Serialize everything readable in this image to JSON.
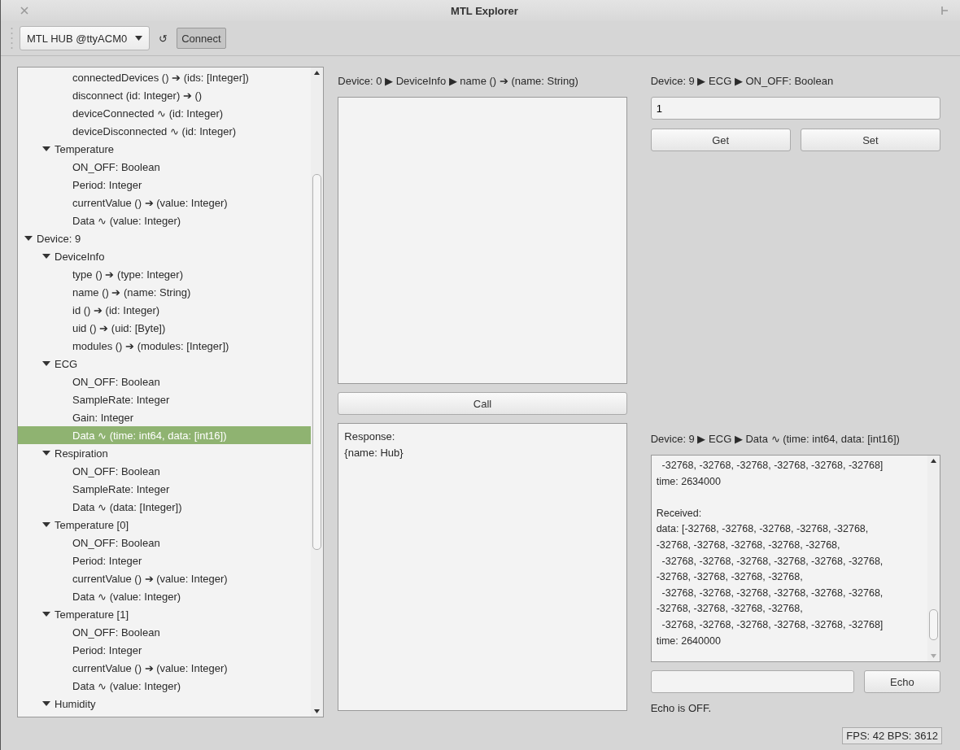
{
  "window": {
    "title": "MTL Explorer"
  },
  "toolbar": {
    "device_select": "MTL HUB @ttyACM0",
    "refresh": "↺",
    "connect": {
      "label": "Connect",
      "pressed": true
    }
  },
  "tree": {
    "items": [
      {
        "children": [
          {
            "children": [
              {
                "label": "connectedDevices () ➔ (ids: [Integer])",
                "selected": false
              },
              {
                "label": "disconnect (id: Integer) ➔ ()",
                "selected": false
              },
              {
                "label": "deviceConnected ∿ (id: Integer)",
                "selected": false
              },
              {
                "label": "deviceDisconnected ∿ (id: Integer)",
                "selected": false
              }
            ]
          },
          {
            "label": "Temperature",
            "expanded": true,
            "children": [
              {
                "label": "ON_OFF: Boolean",
                "selected": false
              },
              {
                "label": "Period: Integer",
                "selected": false
              },
              {
                "label": "currentValue () ➔ (value: Integer)",
                "selected": false
              },
              {
                "label": "Data ∿ (value: Integer)",
                "selected": false
              }
            ]
          }
        ]
      },
      {
        "label": "Device: 9",
        "expanded": true,
        "children": [
          {
            "label": "DeviceInfo",
            "expanded": true,
            "children": [
              {
                "label": "type () ➔ (type: Integer)",
                "selected": false
              },
              {
                "label": "name () ➔ (name: String)",
                "selected": false
              },
              {
                "label": "id () ➔ (id: Integer)",
                "selected": false
              },
              {
                "label": "uid () ➔ (uid: [Byte])",
                "selected": false
              },
              {
                "label": "modules () ➔ (modules: [Integer])",
                "selected": false
              }
            ]
          },
          {
            "label": "ECG",
            "expanded": true,
            "children": [
              {
                "label": "ON_OFF: Boolean",
                "selected": false
              },
              {
                "label": "SampleRate: Integer",
                "selected": false
              },
              {
                "label": "Gain: Integer",
                "selected": false
              },
              {
                "label": "Data ∿ (time: int64, data: [int16])",
                "selected": true
              }
            ]
          },
          {
            "label": "Respiration",
            "expanded": true,
            "children": [
              {
                "label": "ON_OFF: Boolean",
                "selected": false
              },
              {
                "label": "SampleRate: Integer",
                "selected": false
              },
              {
                "label": "Data ∿ (data: [Integer])",
                "selected": false
              }
            ]
          },
          {
            "label": "Temperature [0]",
            "expanded": true,
            "children": [
              {
                "label": "ON_OFF: Boolean",
                "selected": false
              },
              {
                "label": "Period: Integer",
                "selected": false
              },
              {
                "label": "currentValue () ➔ (value: Integer)",
                "selected": false
              },
              {
                "label": "Data ∿ (value: Integer)",
                "selected": false
              }
            ]
          },
          {
            "label": "Temperature [1]",
            "expanded": true,
            "children": [
              {
                "label": "ON_OFF: Boolean",
                "selected": false
              },
              {
                "label": "Period: Integer",
                "selected": false
              },
              {
                "label": "currentValue () ➔ (value: Integer)",
                "selected": false
              },
              {
                "label": "Data ∿ (value: Integer)",
                "selected": false
              }
            ]
          },
          {
            "label": "Humidity",
            "expanded": true
          }
        ]
      }
    ]
  },
  "call_panel": {
    "path": "Device: 0 ▶ DeviceInfo ▶ name () ➔ (name: String)",
    "button": "Call",
    "response": "Response:\n{name: Hub}"
  },
  "property_panel": {
    "path": "Device: 9 ▶ ECG ▶ ON_OFF: Boolean",
    "value": "1",
    "buttons": [
      "Get",
      "Set"
    ]
  },
  "stream_panel": {
    "path": "Device: 9 ▶ ECG ▶ Data ∿ (time: int64, data: [int16])",
    "log": "  -32768, -32768, -32768, -32768, -32768, -32768]\ntime: 2634000\n\nReceived:\ndata: [-32768, -32768, -32768, -32768, -32768,\n-32768, -32768, -32768, -32768, -32768,\n  -32768, -32768, -32768, -32768, -32768, -32768,\n-32768, -32768, -32768, -32768,\n  -32768, -32768, -32768, -32768, -32768, -32768,\n-32768, -32768, -32768, -32768,\n  -32768, -32768, -32768, -32768, -32768, -32768]\ntime: 2640000",
    "echo_button": "Echo",
    "echo_status": "Echo is OFF."
  },
  "status_bar": "FPS: 42 BPS: 3612"
}
